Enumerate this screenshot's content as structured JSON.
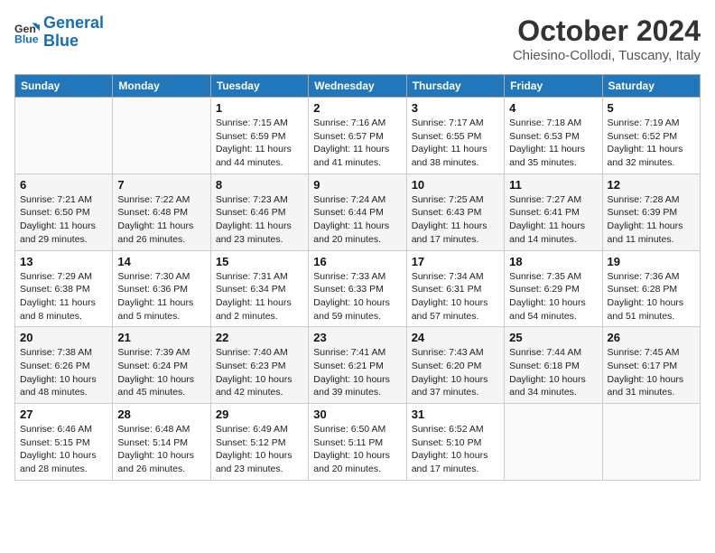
{
  "header": {
    "logo_line1": "General",
    "logo_line2": "Blue",
    "month": "October 2024",
    "location": "Chiesino-Collodi, Tuscany, Italy"
  },
  "weekdays": [
    "Sunday",
    "Monday",
    "Tuesday",
    "Wednesday",
    "Thursday",
    "Friday",
    "Saturday"
  ],
  "weeks": [
    [
      {
        "day": "",
        "sunrise": "",
        "sunset": "",
        "daylight": ""
      },
      {
        "day": "",
        "sunrise": "",
        "sunset": "",
        "daylight": ""
      },
      {
        "day": "1",
        "sunrise": "Sunrise: 7:15 AM",
        "sunset": "Sunset: 6:59 PM",
        "daylight": "Daylight: 11 hours and 44 minutes."
      },
      {
        "day": "2",
        "sunrise": "Sunrise: 7:16 AM",
        "sunset": "Sunset: 6:57 PM",
        "daylight": "Daylight: 11 hours and 41 minutes."
      },
      {
        "day": "3",
        "sunrise": "Sunrise: 7:17 AM",
        "sunset": "Sunset: 6:55 PM",
        "daylight": "Daylight: 11 hours and 38 minutes."
      },
      {
        "day": "4",
        "sunrise": "Sunrise: 7:18 AM",
        "sunset": "Sunset: 6:53 PM",
        "daylight": "Daylight: 11 hours and 35 minutes."
      },
      {
        "day": "5",
        "sunrise": "Sunrise: 7:19 AM",
        "sunset": "Sunset: 6:52 PM",
        "daylight": "Daylight: 11 hours and 32 minutes."
      }
    ],
    [
      {
        "day": "6",
        "sunrise": "Sunrise: 7:21 AM",
        "sunset": "Sunset: 6:50 PM",
        "daylight": "Daylight: 11 hours and 29 minutes."
      },
      {
        "day": "7",
        "sunrise": "Sunrise: 7:22 AM",
        "sunset": "Sunset: 6:48 PM",
        "daylight": "Daylight: 11 hours and 26 minutes."
      },
      {
        "day": "8",
        "sunrise": "Sunrise: 7:23 AM",
        "sunset": "Sunset: 6:46 PM",
        "daylight": "Daylight: 11 hours and 23 minutes."
      },
      {
        "day": "9",
        "sunrise": "Sunrise: 7:24 AM",
        "sunset": "Sunset: 6:44 PM",
        "daylight": "Daylight: 11 hours and 20 minutes."
      },
      {
        "day": "10",
        "sunrise": "Sunrise: 7:25 AM",
        "sunset": "Sunset: 6:43 PM",
        "daylight": "Daylight: 11 hours and 17 minutes."
      },
      {
        "day": "11",
        "sunrise": "Sunrise: 7:27 AM",
        "sunset": "Sunset: 6:41 PM",
        "daylight": "Daylight: 11 hours and 14 minutes."
      },
      {
        "day": "12",
        "sunrise": "Sunrise: 7:28 AM",
        "sunset": "Sunset: 6:39 PM",
        "daylight": "Daylight: 11 hours and 11 minutes."
      }
    ],
    [
      {
        "day": "13",
        "sunrise": "Sunrise: 7:29 AM",
        "sunset": "Sunset: 6:38 PM",
        "daylight": "Daylight: 11 hours and 8 minutes."
      },
      {
        "day": "14",
        "sunrise": "Sunrise: 7:30 AM",
        "sunset": "Sunset: 6:36 PM",
        "daylight": "Daylight: 11 hours and 5 minutes."
      },
      {
        "day": "15",
        "sunrise": "Sunrise: 7:31 AM",
        "sunset": "Sunset: 6:34 PM",
        "daylight": "Daylight: 11 hours and 2 minutes."
      },
      {
        "day": "16",
        "sunrise": "Sunrise: 7:33 AM",
        "sunset": "Sunset: 6:33 PM",
        "daylight": "Daylight: 10 hours and 59 minutes."
      },
      {
        "day": "17",
        "sunrise": "Sunrise: 7:34 AM",
        "sunset": "Sunset: 6:31 PM",
        "daylight": "Daylight: 10 hours and 57 minutes."
      },
      {
        "day": "18",
        "sunrise": "Sunrise: 7:35 AM",
        "sunset": "Sunset: 6:29 PM",
        "daylight": "Daylight: 10 hours and 54 minutes."
      },
      {
        "day": "19",
        "sunrise": "Sunrise: 7:36 AM",
        "sunset": "Sunset: 6:28 PM",
        "daylight": "Daylight: 10 hours and 51 minutes."
      }
    ],
    [
      {
        "day": "20",
        "sunrise": "Sunrise: 7:38 AM",
        "sunset": "Sunset: 6:26 PM",
        "daylight": "Daylight: 10 hours and 48 minutes."
      },
      {
        "day": "21",
        "sunrise": "Sunrise: 7:39 AM",
        "sunset": "Sunset: 6:24 PM",
        "daylight": "Daylight: 10 hours and 45 minutes."
      },
      {
        "day": "22",
        "sunrise": "Sunrise: 7:40 AM",
        "sunset": "Sunset: 6:23 PM",
        "daylight": "Daylight: 10 hours and 42 minutes."
      },
      {
        "day": "23",
        "sunrise": "Sunrise: 7:41 AM",
        "sunset": "Sunset: 6:21 PM",
        "daylight": "Daylight: 10 hours and 39 minutes."
      },
      {
        "day": "24",
        "sunrise": "Sunrise: 7:43 AM",
        "sunset": "Sunset: 6:20 PM",
        "daylight": "Daylight: 10 hours and 37 minutes."
      },
      {
        "day": "25",
        "sunrise": "Sunrise: 7:44 AM",
        "sunset": "Sunset: 6:18 PM",
        "daylight": "Daylight: 10 hours and 34 minutes."
      },
      {
        "day": "26",
        "sunrise": "Sunrise: 7:45 AM",
        "sunset": "Sunset: 6:17 PM",
        "daylight": "Daylight: 10 hours and 31 minutes."
      }
    ],
    [
      {
        "day": "27",
        "sunrise": "Sunrise: 6:46 AM",
        "sunset": "Sunset: 5:15 PM",
        "daylight": "Daylight: 10 hours and 28 minutes."
      },
      {
        "day": "28",
        "sunrise": "Sunrise: 6:48 AM",
        "sunset": "Sunset: 5:14 PM",
        "daylight": "Daylight: 10 hours and 26 minutes."
      },
      {
        "day": "29",
        "sunrise": "Sunrise: 6:49 AM",
        "sunset": "Sunset: 5:12 PM",
        "daylight": "Daylight: 10 hours and 23 minutes."
      },
      {
        "day": "30",
        "sunrise": "Sunrise: 6:50 AM",
        "sunset": "Sunset: 5:11 PM",
        "daylight": "Daylight: 10 hours and 20 minutes."
      },
      {
        "day": "31",
        "sunrise": "Sunrise: 6:52 AM",
        "sunset": "Sunset: 5:10 PM",
        "daylight": "Daylight: 10 hours and 17 minutes."
      },
      {
        "day": "",
        "sunrise": "",
        "sunset": "",
        "daylight": ""
      },
      {
        "day": "",
        "sunrise": "",
        "sunset": "",
        "daylight": ""
      }
    ]
  ]
}
